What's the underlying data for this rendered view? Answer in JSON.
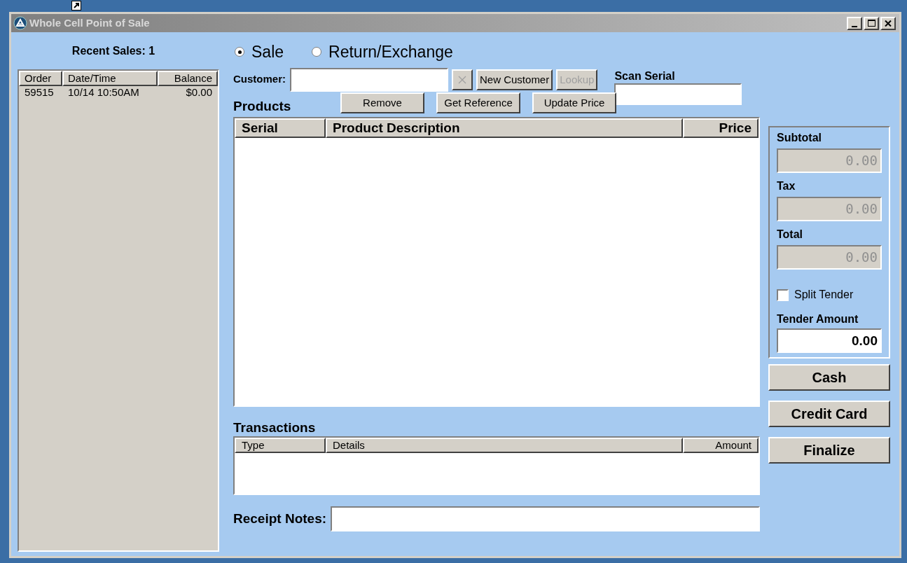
{
  "window": {
    "title": "Whole Cell Point of Sale"
  },
  "recent_sales": {
    "title": "Recent Sales: 1",
    "columns": [
      "Order",
      "Date/Time",
      "Balance"
    ],
    "rows": [
      {
        "cells": [
          "59515",
          "10/14 10:50AM",
          "$0.00"
        ]
      }
    ]
  },
  "mode_options": [
    {
      "label": "Sale",
      "selected": true
    },
    {
      "label": "Return/Exchange",
      "selected": false
    }
  ],
  "customer": {
    "label": "Customer:",
    "clear_disabled": true,
    "buttons": [
      {
        "label": "New Customer",
        "disabled": false
      },
      {
        "label": "Lookup",
        "disabled": true
      }
    ]
  },
  "scan_serial": {
    "label": "Scan Serial"
  },
  "products": {
    "title": "Products",
    "buttons": [
      "Remove",
      "Get Reference",
      "Update Price"
    ],
    "columns": [
      "Serial",
      "Product Description",
      "Price"
    ]
  },
  "totals": {
    "fields": [
      {
        "label": "Subtotal",
        "value": "0.00",
        "disabled": true
      },
      {
        "label": "Tax",
        "value": "0.00",
        "disabled": true
      },
      {
        "label": "Total",
        "value": "0.00",
        "disabled": true
      }
    ],
    "split_tender": {
      "label": "Split Tender",
      "checked": false
    },
    "tender_amount": {
      "label": "Tender Amount",
      "value": "0.00",
      "disabled": false
    }
  },
  "actions": [
    "Cash",
    "Credit Card",
    "Finalize"
  ],
  "transactions": {
    "title": "Transactions",
    "columns": [
      "Type",
      "Details",
      "Amount"
    ]
  },
  "receipt_notes": {
    "label": "Receipt Notes:"
  }
}
